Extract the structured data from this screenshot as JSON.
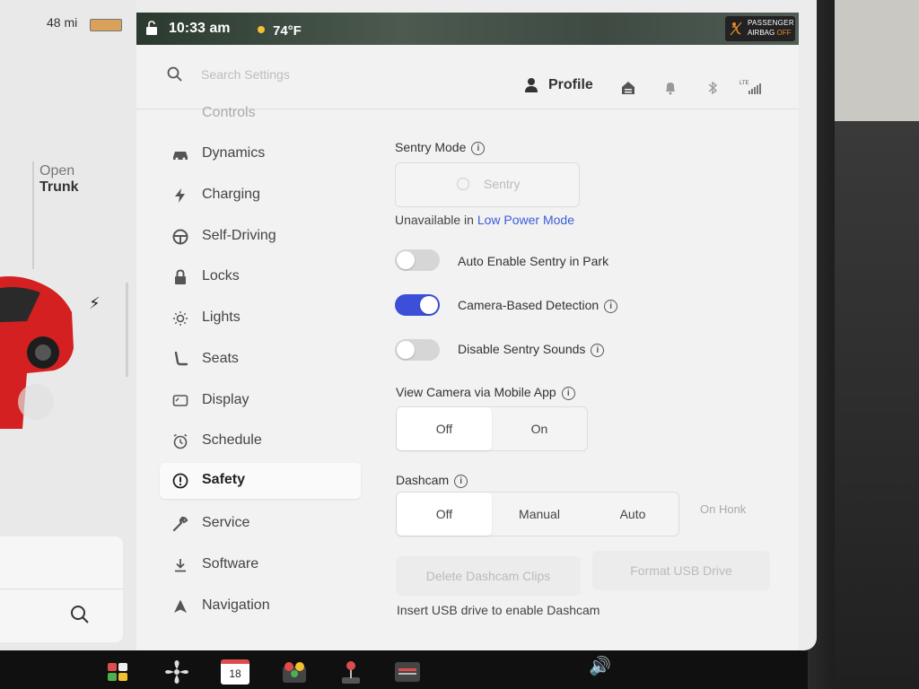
{
  "car": {
    "range": "48 mi",
    "trunk_open": "Open",
    "trunk_label": "Trunk"
  },
  "status": {
    "time": "10:33 am",
    "temperature": "74°F",
    "airbag_line1": "PASSENGER",
    "airbag_line2": "AIRBAG",
    "airbag_state": "OFF"
  },
  "header": {
    "search_placeholder": "Search Settings",
    "profile_label": "Profile"
  },
  "menu": [
    {
      "label": "Controls",
      "icon": "controls-icon"
    },
    {
      "label": "Dynamics",
      "icon": "car-icon"
    },
    {
      "label": "Charging",
      "icon": "bolt-icon"
    },
    {
      "label": "Self-Driving",
      "icon": "steering-wheel-icon"
    },
    {
      "label": "Locks",
      "icon": "lock-icon"
    },
    {
      "label": "Lights",
      "icon": "lights-icon"
    },
    {
      "label": "Seats",
      "icon": "seat-icon"
    },
    {
      "label": "Display",
      "icon": "display-icon"
    },
    {
      "label": "Schedule",
      "icon": "schedule-icon"
    },
    {
      "label": "Safety",
      "icon": "safety-icon"
    },
    {
      "label": "Service",
      "icon": "wrench-icon"
    },
    {
      "label": "Software",
      "icon": "download-icon"
    },
    {
      "label": "Navigation",
      "icon": "navigation-icon"
    }
  ],
  "active_menu": "Safety",
  "sentry": {
    "title": "Sentry Mode",
    "button_label": "Sentry",
    "unavailable_prefix": "Unavailable in",
    "unavailable_link": "Low Power Mode"
  },
  "toggles": [
    {
      "label": "Auto Enable Sentry in Park",
      "on": false,
      "info": false
    },
    {
      "label": "Camera-Based Detection",
      "on": true,
      "info": true
    },
    {
      "label": "Disable Sentry Sounds",
      "on": false,
      "info": true
    }
  ],
  "view_camera": {
    "title": "View Camera via Mobile App",
    "options": [
      "Off",
      "On"
    ],
    "selected": "Off"
  },
  "dashcam": {
    "title": "Dashcam",
    "options": [
      "Off",
      "Manual",
      "Auto"
    ],
    "selected": "Off",
    "extra_option": "On Honk",
    "delete_label": "Delete Dashcam Clips",
    "format_label": "Format USB Drive",
    "usb_note": "Insert USB drive to enable Dashcam"
  },
  "dock": {
    "calendar_day": "18"
  },
  "colors": {
    "accent": "#3b4fd8",
    "link": "#3b5bdb",
    "car_red": "#d42020",
    "airbag_off": "#e58a2a"
  }
}
